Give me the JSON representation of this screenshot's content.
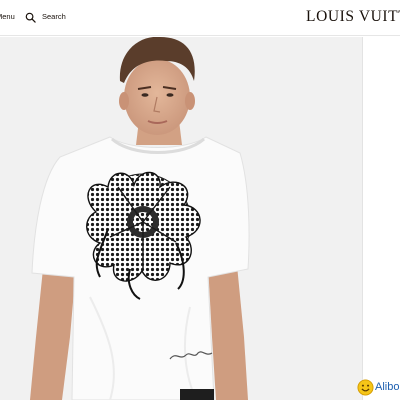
{
  "header": {
    "menu_label": "Menu",
    "search_label": "Search",
    "search_icon": "search-icon",
    "brand": "LOUIS VUITTON"
  },
  "product_image": {
    "description_icon": "tshirt-photo",
    "signature_text": "Lorsparl"
  },
  "watermark": {
    "text": "Alibob",
    "icon": "smiley-emoji-icon"
  },
  "colors": {
    "background": "#ffffff",
    "image_background": "#f1f1f1",
    "brand_text": "#19110b",
    "watermark_text": "#1d5fb0"
  }
}
